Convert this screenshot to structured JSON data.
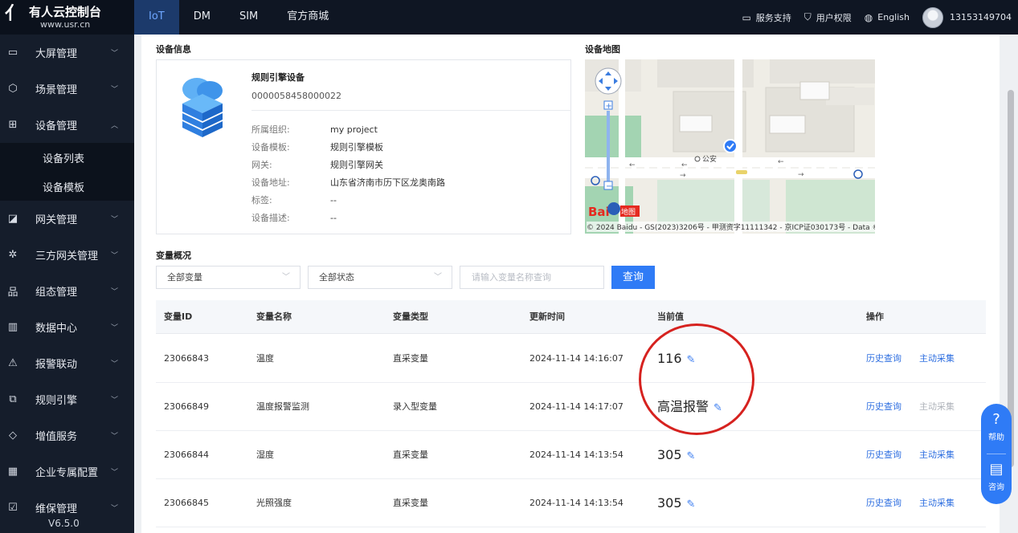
{
  "app": {
    "logo_mark": "亻",
    "name": "有人云控制台",
    "url": "www.usr.cn",
    "version": "V6.5.0"
  },
  "topnav": {
    "tabs": [
      {
        "label": "IoT",
        "active": true
      },
      {
        "label": "DM"
      },
      {
        "label": "SIM"
      },
      {
        "label": "官方商城"
      }
    ],
    "right": {
      "support": "服务支持",
      "permission": "用户权限",
      "language": "English",
      "user": "13153149704"
    }
  },
  "sidebar": {
    "items": [
      {
        "label": "大屏管理",
        "icon": "monitor-icon",
        "glyph": "▭",
        "chev": "﹀"
      },
      {
        "label": "场景管理",
        "icon": "cube-icon",
        "glyph": "⬡",
        "chev": "﹀"
      },
      {
        "label": "设备管理",
        "icon": "device-grid-icon",
        "glyph": "⊞",
        "chev": "︿"
      },
      {
        "label": "网关管理",
        "icon": "chart-line-icon",
        "glyph": "◪",
        "chev": "﹀"
      },
      {
        "label": "三方网关管理",
        "icon": "network-icon",
        "glyph": "✲",
        "chev": "﹀"
      },
      {
        "label": "组态管理",
        "icon": "org-icon",
        "glyph": "品",
        "chev": "﹀"
      },
      {
        "label": "数据中心",
        "icon": "bar-chart-icon",
        "glyph": "▥",
        "chev": "﹀"
      },
      {
        "label": "报警联动",
        "icon": "alarm-icon",
        "glyph": "⚠",
        "chev": "﹀"
      },
      {
        "label": "规则引擎",
        "icon": "rules-icon",
        "glyph": "⧉",
        "chev": "﹀"
      },
      {
        "label": "增值服务",
        "icon": "diamond-icon",
        "glyph": "◇",
        "chev": "﹀"
      },
      {
        "label": "企业专属配置",
        "icon": "building-icon",
        "glyph": "▦",
        "chev": "﹀"
      },
      {
        "label": "维保管理",
        "icon": "maintenance-icon",
        "glyph": "☑",
        "chev": "﹀"
      }
    ],
    "subitems": [
      {
        "label": "设备列表"
      },
      {
        "label": "设备模板"
      }
    ]
  },
  "device_info": {
    "section_title": "设备信息",
    "name": "规则引擎设备",
    "sn": "0000058458000022",
    "fields": [
      {
        "key": "所属组织:",
        "value": "my project"
      },
      {
        "key": "设备模板:",
        "value": "规则引擎模板"
      },
      {
        "key": "网关:",
        "value": "规则引擎网关"
      },
      {
        "key": "设备地址:",
        "value": "山东省济南市历下区龙奥南路"
      },
      {
        "key": "标签:",
        "value": "--"
      },
      {
        "key": "设备描述:",
        "value": "--"
      }
    ]
  },
  "device_map": {
    "section_title": "设备地图",
    "poi_label": "公安",
    "logo_text": "Bai",
    "logo_text2": "地图",
    "copyright": "© 2024 Baidu - GS(2023)3206号 - 甲测资字11111342 - 京ICP证030173号 - Data ©"
  },
  "variables": {
    "section_title": "变量概况",
    "filter_all_vars": "全部变量",
    "filter_all_status": "全部状态",
    "search_placeholder": "请输入变量名称查询",
    "query_button": "查询",
    "columns": {
      "id": "变量ID",
      "name": "变量名称",
      "type": "变量类型",
      "time": "更新时间",
      "value": "当前值",
      "ops": "操作"
    },
    "rows": [
      {
        "id": "23066843",
        "name": "温度",
        "type": "直采变量",
        "time": "2024-11-14 14:16:07",
        "value": "116",
        "history": "历史查询",
        "collect": "主动采集",
        "collect_enabled": true
      },
      {
        "id": "23066849",
        "name": "温度报警监测",
        "type": "录入型变量",
        "time": "2024-11-14 14:17:07",
        "value": "高温报警",
        "history": "历史查询",
        "collect": "主动采集",
        "collect_enabled": false
      },
      {
        "id": "23066844",
        "name": "湿度",
        "type": "直采变量",
        "time": "2024-11-14 14:13:54",
        "value": "305",
        "history": "历史查询",
        "collect": "主动采集",
        "collect_enabled": true
      },
      {
        "id": "23066845",
        "name": "光照强度",
        "type": "直采变量",
        "time": "2024-11-14 14:13:54",
        "value": "305",
        "history": "历史查询",
        "collect": "主动采集",
        "collect_enabled": true
      }
    ]
  },
  "float_help": {
    "help_label": "帮助",
    "consult_label": "咨询"
  },
  "colors": {
    "primary": "#2f7bf6",
    "sidebar_bg": "#151d2b",
    "topbar_bg": "#0f1623",
    "highlight": "#d6221f"
  }
}
